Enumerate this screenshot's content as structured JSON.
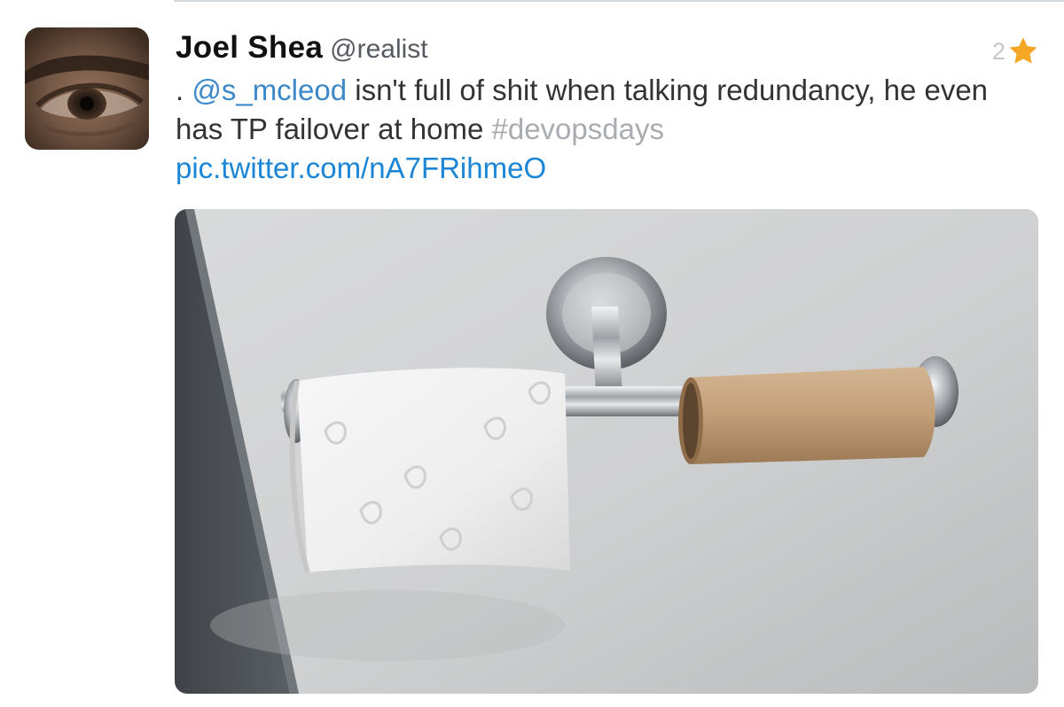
{
  "tweet": {
    "author_name": "Joel Shea",
    "author_handle": "@realist",
    "favorite_count": "2",
    "text_prefix": ". ",
    "mention": "@s_mcleod",
    "text_body": " isn't full of shit when talking redundancy, he even has TP failover at home ",
    "hashtag": "#devopsdays",
    "link_text": "pic.twitter.com/nA7FRihmeO"
  },
  "icons": {
    "favorite": "star-icon",
    "avatar": "avatar-eye-photo",
    "media": "toilet-paper-photo"
  },
  "colors": {
    "link": "#1b86d6",
    "mention": "#3c88c9",
    "hashtag": "#a8acb0",
    "star": "#f5a623"
  }
}
